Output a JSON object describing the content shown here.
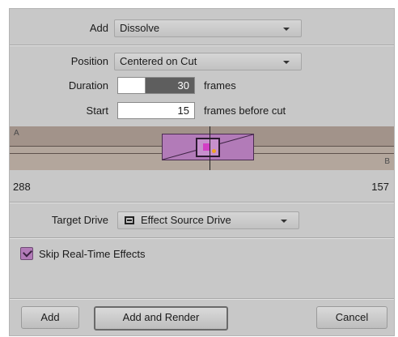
{
  "add": {
    "label": "Add",
    "value": "Dissolve"
  },
  "position": {
    "label": "Position",
    "value": "Centered on Cut"
  },
  "duration": {
    "label": "Duration",
    "value": "30",
    "unit": "frames"
  },
  "start": {
    "label": "Start",
    "value": "15",
    "unit": "frames before cut"
  },
  "timeline": {
    "track_a": "A",
    "track_b": "B",
    "left_number": "288",
    "right_number": "157"
  },
  "target_drive": {
    "label": "Target Drive",
    "value": "Effect Source Drive",
    "icon": "drive-icon"
  },
  "skip_realtime": {
    "label": "Skip Real-Time Effects",
    "checked": true
  },
  "buttons": {
    "add": "Add",
    "add_and_render": "Add and Render",
    "cancel": "Cancel"
  },
  "colors": {
    "dialog_bg": "#c8c8c8",
    "accent_purple": "#b27bb8",
    "timeline_bg": "#a89a90"
  }
}
